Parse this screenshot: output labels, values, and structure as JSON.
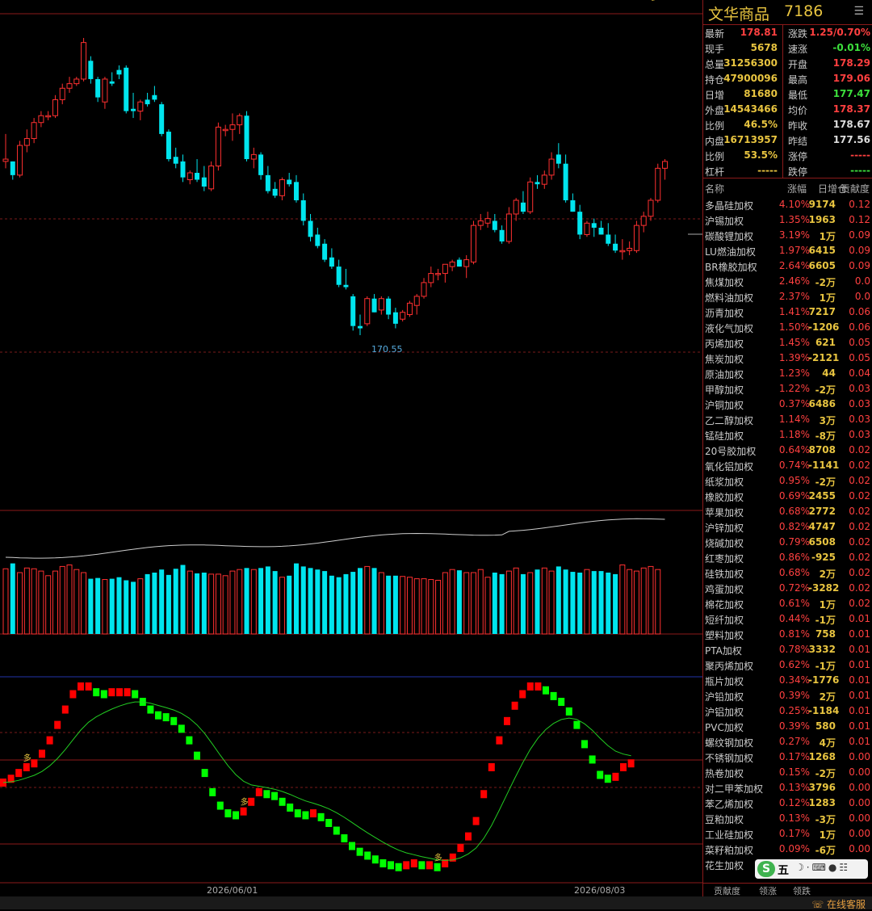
{
  "header": {
    "title": "文华商品",
    "code": "7186",
    "menu_icon": "list-icon"
  },
  "quote": {
    "left": [
      {
        "label": "最新",
        "value": "178.81",
        "color": "#ff4040"
      },
      {
        "label": "现手",
        "value": "5678",
        "color": "#e8c440"
      },
      {
        "label": "总量",
        "value": "31256300",
        "color": "#e8c440"
      },
      {
        "label": "持仓",
        "value": "47900096",
        "color": "#e8c440"
      },
      {
        "label": "日增",
        "value": "81680",
        "color": "#e8c440"
      },
      {
        "label": "外盘",
        "value": "14543466",
        "color": "#e8c440"
      },
      {
        "label": "比例",
        "value": "46.5%",
        "color": "#e8c440"
      },
      {
        "label": "内盘",
        "value": "16713957",
        "color": "#e8c440"
      },
      {
        "label": "比例",
        "value": "53.5%",
        "color": "#e8c440"
      },
      {
        "label": "杠杆",
        "value": "-----",
        "color": "#e8c440"
      }
    ],
    "right": [
      {
        "label": "涨跌",
        "value": "1.25/0.70%",
        "color": "#ff4040"
      },
      {
        "label": "速涨",
        "value": "-0.01%",
        "color": "#3ce03c"
      },
      {
        "label": "开盘",
        "value": "178.29",
        "color": "#ff4040"
      },
      {
        "label": "最高",
        "value": "179.06",
        "color": "#ff4040"
      },
      {
        "label": "最低",
        "value": "177.47",
        "color": "#3ce03c"
      },
      {
        "label": "均价",
        "value": "178.37",
        "color": "#ff4040"
      },
      {
        "label": "昨收",
        "value": "178.67",
        "color": "#dddddd"
      },
      {
        "label": "昨结",
        "value": "177.56",
        "color": "#dddddd"
      },
      {
        "label": "涨停",
        "value": "-----",
        "color": "#ff4040"
      },
      {
        "label": "跌停",
        "value": "-----",
        "color": "#3ce03c"
      }
    ]
  },
  "components": {
    "headers": {
      "name": "名称",
      "pct": "涨幅",
      "oi": "日增仓",
      "contrib": "贡献度"
    },
    "rows": [
      {
        "name": "多晶硅加权",
        "pct": "4.10%",
        "oi": "9174",
        "contrib": "0.12"
      },
      {
        "name": "沪锡加权",
        "pct": "1.35%",
        "oi": "1963",
        "contrib": "0.12"
      },
      {
        "name": "碳酸锂加权",
        "pct": "3.19%",
        "oi": "1万",
        "contrib": "0.09"
      },
      {
        "name": "LU燃油加权",
        "pct": "1.97%",
        "oi": "6415",
        "contrib": "0.09"
      },
      {
        "name": "BR橡胶加权",
        "pct": "2.64%",
        "oi": "6605",
        "contrib": "0.09"
      },
      {
        "name": "焦煤加权",
        "pct": "2.46%",
        "oi": "-2万",
        "contrib": "0.0"
      },
      {
        "name": "燃料油加权",
        "pct": "2.37%",
        "oi": "1万",
        "contrib": "0.0"
      },
      {
        "name": "沥青加权",
        "pct": "1.41%",
        "oi": "7217",
        "contrib": "0.06"
      },
      {
        "name": "液化气加权",
        "pct": "1.50%",
        "oi": "-1206",
        "contrib": "0.06"
      },
      {
        "name": "丙烯加权",
        "pct": "1.45%",
        "oi": "621",
        "contrib": "0.05"
      },
      {
        "name": "焦炭加权",
        "pct": "1.39%",
        "oi": "-2121",
        "contrib": "0.05"
      },
      {
        "name": "原油加权",
        "pct": "1.23%",
        "oi": "44",
        "contrib": "0.04"
      },
      {
        "name": "甲醇加权",
        "pct": "1.22%",
        "oi": "-2万",
        "contrib": "0.03"
      },
      {
        "name": "沪铜加权",
        "pct": "0.37%",
        "oi": "6486",
        "contrib": "0.03"
      },
      {
        "name": "乙二醇加权",
        "pct": "1.14%",
        "oi": "3万",
        "contrib": "0.03"
      },
      {
        "name": "锰硅加权",
        "pct": "1.18%",
        "oi": "-8万",
        "contrib": "0.03"
      },
      {
        "name": "20号胶加权",
        "pct": "0.64%",
        "oi": "8708",
        "contrib": "0.02"
      },
      {
        "name": "氧化铝加权",
        "pct": "0.74%",
        "oi": "-1141",
        "contrib": "0.02"
      },
      {
        "name": "纸浆加权",
        "pct": "0.95%",
        "oi": "-2万",
        "contrib": "0.02"
      },
      {
        "name": "橡胶加权",
        "pct": "0.69%",
        "oi": "2455",
        "contrib": "0.02"
      },
      {
        "name": "苹果加权",
        "pct": "0.68%",
        "oi": "2772",
        "contrib": "0.02"
      },
      {
        "name": "沪锌加权",
        "pct": "0.82%",
        "oi": "4747",
        "contrib": "0.02"
      },
      {
        "name": "烧碱加权",
        "pct": "0.79%",
        "oi": "6508",
        "contrib": "0.02"
      },
      {
        "name": "红枣加权",
        "pct": "0.86%",
        "oi": "-925",
        "contrib": "0.02"
      },
      {
        "name": "硅铁加权",
        "pct": "0.68%",
        "oi": "2万",
        "contrib": "0.02"
      },
      {
        "name": "鸡蛋加权",
        "pct": "0.72%",
        "oi": "-3282",
        "contrib": "0.02"
      },
      {
        "name": "棉花加权",
        "pct": "0.61%",
        "oi": "1万",
        "contrib": "0.02"
      },
      {
        "name": "短纤加权",
        "pct": "0.44%",
        "oi": "-1万",
        "contrib": "0.01"
      },
      {
        "name": "塑料加权",
        "pct": "0.81%",
        "oi": "758",
        "contrib": "0.01"
      },
      {
        "name": "PTA加权",
        "pct": "0.78%",
        "oi": "3332",
        "contrib": "0.01"
      },
      {
        "name": "聚丙烯加权",
        "pct": "0.62%",
        "oi": "-1万",
        "contrib": "0.01"
      },
      {
        "name": "瓶片加权",
        "pct": "0.34%",
        "oi": "-1776",
        "contrib": "0.01"
      },
      {
        "name": "沪铅加权",
        "pct": "0.39%",
        "oi": "2万",
        "contrib": "0.01"
      },
      {
        "name": "沪铝加权",
        "pct": "0.25%",
        "oi": "-1184",
        "contrib": "0.01"
      },
      {
        "name": "PVC加权",
        "pct": "0.39%",
        "oi": "580",
        "contrib": "0.01"
      },
      {
        "name": "螺纹钢加权",
        "pct": "0.27%",
        "oi": "4万",
        "contrib": "0.01"
      },
      {
        "name": "不锈钢加权",
        "pct": "0.17%",
        "oi": "1268",
        "contrib": "0.00"
      },
      {
        "name": "热卷加权",
        "pct": "0.15%",
        "oi": "-2万",
        "contrib": "0.00"
      },
      {
        "name": "对二甲苯加权",
        "pct": "0.13%",
        "oi": "3796",
        "contrib": "0.00"
      },
      {
        "name": "苯乙烯加权",
        "pct": "0.12%",
        "oi": "1283",
        "contrib": "0.00"
      },
      {
        "name": "豆粕加权",
        "pct": "0.13%",
        "oi": "-3万",
        "contrib": "0.00"
      },
      {
        "name": "工业硅加权",
        "pct": "0.17%",
        "oi": "1万",
        "contrib": "0.00"
      },
      {
        "name": "菜籽粕加权",
        "pct": "0.09%",
        "oi": "-6万",
        "contrib": "0.00"
      },
      {
        "name": "花生加权",
        "pct": "",
        "oi": "",
        "contrib": ""
      }
    ]
  },
  "tabs": [
    "贡献度",
    "领涨",
    "领跌"
  ],
  "ime": {
    "logo": "S",
    "mode": "五"
  },
  "customer_service": "在线客服",
  "chart_data": {
    "type": "candlestick",
    "low_label": "170.55",
    "x_labels": [
      "2026/06/01",
      "2026/08/03"
    ],
    "signal_label": "多",
    "colors": {
      "up": "#ff3030",
      "down": "#00e5ee",
      "ind_up": "#ff0000",
      "ind_down": "#00ff00"
    },
    "candles": [
      [
        177.2,
        178.4,
        176.9,
        177.3
      ],
      [
        177.2,
        177.2,
        176.4,
        176.6
      ],
      [
        176.6,
        178.1,
        176.5,
        177.9
      ],
      [
        177.9,
        178.6,
        177.6,
        178.2
      ],
      [
        178.2,
        179.1,
        178.0,
        178.9
      ],
      [
        178.9,
        179.4,
        178.7,
        179.2
      ],
      [
        179.2,
        179.4,
        179.0,
        179.2
      ],
      [
        179.2,
        180.1,
        179.1,
        179.9
      ],
      [
        179.9,
        180.6,
        179.7,
        180.4
      ],
      [
        180.4,
        180.9,
        180.2,
        180.6
      ],
      [
        180.6,
        180.9,
        180.5,
        180.8
      ],
      [
        180.8,
        182.6,
        180.7,
        182.4
      ],
      [
        181.6,
        181.8,
        180.6,
        180.8
      ],
      [
        180.8,
        180.9,
        179.8,
        180.0
      ],
      [
        179.8,
        180.9,
        179.5,
        180.8
      ],
      [
        180.7,
        181.1,
        180.5,
        180.6
      ],
      [
        181.2,
        181.4,
        180.8,
        181.0
      ],
      [
        181.3,
        181.4,
        179.3,
        179.4
      ],
      [
        179.5,
        180.2,
        179.1,
        179.4
      ],
      [
        179.4,
        179.9,
        179.0,
        179.8
      ],
      [
        179.9,
        180.2,
        179.6,
        179.7
      ],
      [
        180.1,
        180.5,
        179.8,
        179.9
      ],
      [
        179.7,
        179.8,
        178.3,
        178.4
      ],
      [
        178.5,
        178.6,
        177.2,
        177.3
      ],
      [
        177.4,
        177.8,
        176.9,
        177.1
      ],
      [
        177.2,
        177.5,
        176.3,
        176.5
      ],
      [
        176.4,
        176.8,
        176.2,
        176.7
      ],
      [
        176.7,
        177.3,
        176.3,
        176.4
      ],
      [
        176.5,
        177.0,
        175.9,
        176.1
      ],
      [
        176.0,
        177.2,
        175.9,
        177.0
      ],
      [
        177.0,
        178.9,
        176.8,
        178.7
      ],
      [
        178.6,
        178.8,
        178.3,
        178.6
      ],
      [
        178.6,
        179.3,
        178.1,
        178.8
      ],
      [
        178.8,
        179.3,
        178.4,
        179.2
      ],
      [
        179.2,
        179.4,
        177.2,
        177.3
      ],
      [
        177.3,
        177.8,
        176.9,
        177.5
      ],
      [
        177.5,
        177.6,
        176.4,
        176.6
      ],
      [
        176.6,
        177.0,
        175.8,
        175.9
      ],
      [
        176.0,
        176.3,
        175.6,
        175.7
      ],
      [
        175.7,
        176.5,
        175.5,
        176.4
      ],
      [
        176.4,
        176.7,
        176.1,
        176.2
      ],
      [
        176.3,
        176.6,
        175.4,
        175.5
      ],
      [
        175.5,
        175.8,
        174.4,
        174.6
      ],
      [
        174.6,
        174.9,
        173.7,
        173.9
      ],
      [
        174.0,
        174.3,
        173.4,
        173.5
      ],
      [
        173.6,
        173.8,
        172.8,
        172.9
      ],
      [
        173.0,
        173.4,
        172.5,
        172.6
      ],
      [
        172.6,
        172.9,
        171.7,
        171.8
      ],
      [
        171.8,
        172.5,
        171.6,
        171.7
      ],
      [
        171.3,
        171.4,
        169.8,
        170.0
      ],
      [
        170.0,
        170.5,
        169.6,
        169.9
      ],
      [
        170.1,
        171.3,
        170.0,
        171.2
      ],
      [
        171.2,
        171.4,
        170.6,
        170.6
      ],
      [
        170.7,
        171.3,
        170.5,
        171.2
      ],
      [
        171.2,
        171.3,
        170.3,
        170.5
      ],
      [
        170.6,
        170.8,
        169.9,
        170.1
      ],
      [
        170.3,
        170.7,
        170.2,
        170.6
      ],
      [
        170.5,
        171.1,
        170.4,
        171.0
      ],
      [
        170.9,
        171.4,
        170.5,
        171.3
      ],
      [
        171.3,
        172.1,
        171.2,
        171.9
      ],
      [
        171.9,
        172.6,
        171.7,
        172.3
      ],
      [
        172.3,
        172.5,
        172.0,
        172.3
      ],
      [
        172.3,
        172.7,
        171.9,
        172.7
      ],
      [
        172.6,
        172.9,
        172.4,
        172.8
      ],
      [
        172.9,
        173.0,
        172.6,
        172.6
      ],
      [
        172.6,
        173.1,
        172.1,
        172.9
      ],
      [
        172.8,
        174.6,
        172.7,
        174.4
      ],
      [
        174.4,
        174.9,
        174.2,
        174.6
      ],
      [
        174.5,
        175.0,
        174.3,
        174.7
      ],
      [
        174.6,
        174.9,
        174.1,
        174.2
      ],
      [
        174.2,
        174.4,
        173.6,
        173.7
      ],
      [
        173.7,
        175.2,
        173.6,
        174.9
      ],
      [
        174.9,
        175.6,
        174.6,
        175.5
      ],
      [
        175.4,
        175.9,
        174.9,
        175.0
      ],
      [
        175.0,
        176.5,
        174.9,
        176.3
      ],
      [
        176.3,
        176.6,
        176.0,
        176.2
      ],
      [
        176.2,
        176.8,
        176.0,
        176.6
      ],
      [
        176.6,
        177.6,
        176.4,
        177.3
      ],
      [
        177.5,
        178.0,
        176.9,
        177.1
      ],
      [
        177.1,
        177.5,
        175.4,
        175.5
      ],
      [
        175.5,
        175.8,
        175.0,
        175.0
      ],
      [
        175.0,
        175.3,
        173.8,
        174.0
      ],
      [
        174.0,
        174.6,
        173.9,
        174.5
      ],
      [
        174.5,
        174.7,
        173.9,
        174.3
      ],
      [
        174.3,
        174.6,
        174.0,
        174.0
      ],
      [
        174.0,
        174.5,
        173.5,
        173.6
      ],
      [
        173.6,
        174.0,
        173.2,
        173.3
      ],
      [
        173.3,
        173.8,
        172.9,
        173.3
      ],
      [
        173.3,
        173.7,
        173.1,
        173.4
      ],
      [
        173.3,
        174.6,
        173.2,
        174.4
      ],
      [
        174.4,
        175.0,
        174.1,
        174.8
      ],
      [
        174.8,
        175.6,
        174.6,
        175.5
      ],
      [
        175.5,
        177.1,
        175.4,
        176.9
      ],
      [
        176.9,
        177.3,
        176.4,
        177.2
      ]
    ],
    "volumes": [
      0.85,
      0.92,
      0.8,
      0.86,
      0.85,
      0.82,
      0.76,
      0.82,
      0.88,
      0.9,
      0.84,
      0.8,
      0.72,
      0.73,
      0.71,
      0.72,
      0.74,
      0.7,
      0.68,
      0.72,
      0.78,
      0.8,
      0.84,
      0.77,
      0.85,
      0.9,
      0.82,
      0.79,
      0.8,
      0.78,
      0.78,
      0.76,
      0.82,
      0.84,
      0.86,
      0.84,
      0.86,
      0.88,
      0.82,
      0.74,
      0.76,
      0.92,
      0.88,
      0.86,
      0.84,
      0.82,
      0.76,
      0.74,
      0.78,
      0.81,
      0.86,
      0.88,
      0.86,
      0.8,
      0.76,
      0.76,
      0.75,
      0.74,
      0.72,
      0.72,
      0.71,
      0.7,
      0.8,
      0.84,
      0.83,
      0.8,
      0.8,
      0.84,
      0.74,
      0.8,
      0.78,
      0.82,
      0.86,
      0.78,
      0.8,
      0.84,
      0.86,
      0.82,
      0.88,
      0.84,
      0.81,
      0.8,
      0.84,
      0.82,
      0.82,
      0.8,
      0.78,
      0.9,
      0.84,
      0.82,
      0.86,
      0.88,
      0.84
    ],
    "indicator": [
      50,
      52,
      55,
      58,
      60,
      65,
      72,
      80,
      88,
      96,
      100,
      100,
      97,
      96,
      97,
      97,
      97,
      96,
      92,
      88,
      85,
      84,
      82,
      78,
      72,
      64,
      55,
      45,
      38,
      34,
      33,
      35,
      40,
      45,
      44,
      43,
      40,
      37,
      34,
      33,
      34,
      32,
      29,
      25,
      21,
      17,
      14,
      12,
      10,
      8,
      7,
      6,
      7,
      8,
      7,
      7,
      6,
      8,
      11,
      16,
      22,
      30,
      44,
      58,
      72,
      82,
      90,
      96,
      100,
      100,
      98,
      95,
      92,
      87,
      80,
      70,
      62,
      54,
      52,
      53,
      58,
      60
    ]
  }
}
